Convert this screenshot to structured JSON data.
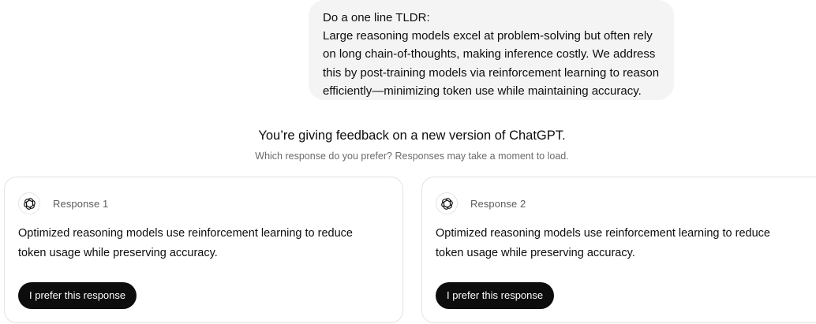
{
  "user_message": {
    "lines": [
      "Do a one line TLDR:",
      "Large reasoning models excel at problem-solving but often rely",
      "on long chain-of-thoughts, making inference costly. We address",
      "this by post-training models via reinforcement learning to reason",
      "efficiently—minimizing token use while maintaining accuracy."
    ]
  },
  "feedback": {
    "title": "You’re giving feedback on a new version of ChatGPT.",
    "subtitle": "Which response do you prefer? Responses may take a moment to load."
  },
  "responses": [
    {
      "label": "Response 1",
      "icon": "openai-logo-icon",
      "lines": [
        "Optimized reasoning models use reinforcement learning to reduce",
        "token usage while preserving accuracy."
      ],
      "button_label": "I prefer this response"
    },
    {
      "label": "Response 2",
      "icon": "openai-logo-icon",
      "lines": [
        "Optimized reasoning models use reinforcement learning to reduce",
        "token usage while preserving accuracy."
      ],
      "button_label": "I prefer this response"
    }
  ],
  "colors": {
    "bubble_bg": "#f4f4f4",
    "button_bg": "#0d0d0d",
    "button_text": "#ffffff",
    "border": "#e3e3e3",
    "muted_text": "#6b6b6b"
  }
}
